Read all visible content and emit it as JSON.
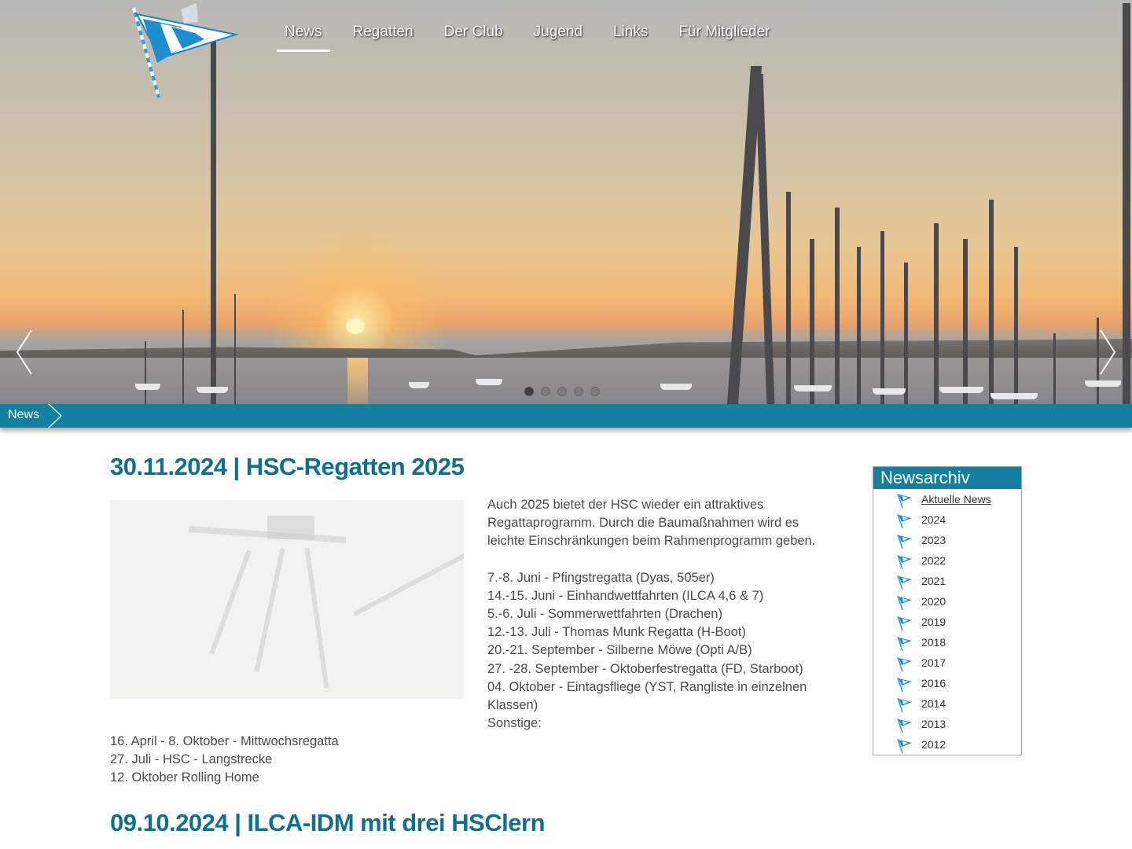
{
  "nav": {
    "items": [
      {
        "label": "News",
        "active": true
      },
      {
        "label": "Regatten",
        "active": false
      },
      {
        "label": "Der Club",
        "active": false
      },
      {
        "label": "Jugend",
        "active": false
      },
      {
        "label": "Links",
        "active": false
      },
      {
        "label": "Für Mitglieder",
        "active": false
      }
    ]
  },
  "slider": {
    "slide_count": 5,
    "active_slide": 1
  },
  "breadcrumb": {
    "label": "News"
  },
  "posts": [
    {
      "title": "30.11.2024 | HSC-Regatten 2025",
      "intro": "Auch 2025 bietet der HSC wieder ein attraktives Regattaprogramm. Durch die Baumaßnahmen wird es leichte Einschränkungen beim Rahmenprogramm geben.",
      "events": [
        "7.-8. Juni - Pfingstregatta (Dyas, 505er)",
        "14.-15. Juni - Einhandwettfahrten (ILCA 4,6 & 7)",
        "5.-6. Juli - Sommerwettfahrten (Drachen)",
        "12.-13. Juli - Thomas Munk Regatta (H-Boot)",
        "20.-21. September - Silberne Möwe (Opti A/B)",
        "27. -28. September - Oktoberfestregatta (FD, Starboot)",
        "04. Oktober - Eintagsfliege (YST, Rangliste in einzelnen Klassen)"
      ],
      "other_label": "Sonstige:",
      "other_events": [
        "16. April - 8. Oktober - Mittwochsregatta",
        "27. Juli - HSC - Langstrecke",
        "12. Oktober Rolling Home"
      ]
    },
    {
      "title": "09.10.2024 | ILCA-IDM mit drei HSClern"
    }
  ],
  "sidebar": {
    "title": "Newsarchiv",
    "items": [
      {
        "label": "Aktuelle News",
        "current": true
      },
      {
        "label": "2024"
      },
      {
        "label": "2023"
      },
      {
        "label": "2022"
      },
      {
        "label": "2021"
      },
      {
        "label": "2020"
      },
      {
        "label": "2019"
      },
      {
        "label": "2018"
      },
      {
        "label": "2017"
      },
      {
        "label": "2016"
      },
      {
        "label": "2014"
      },
      {
        "label": "2013"
      },
      {
        "label": "2012"
      }
    ]
  },
  "colors": {
    "brand": "#13809f",
    "title": "#0f6f8e"
  }
}
